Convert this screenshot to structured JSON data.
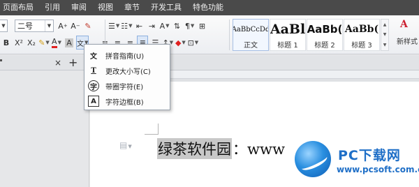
{
  "menubar": {
    "items": [
      "页面布局",
      "引用",
      "审阅",
      "视图",
      "章节",
      "开发工具",
      "特色功能"
    ]
  },
  "ribbon": {
    "font_size": "二号",
    "bold_label": "B",
    "pinyin_glyph": "文",
    "styles": [
      {
        "sample": "AaBbCcDd",
        "name": "正文"
      },
      {
        "sample": "AaBl",
        "name": "标题 1"
      },
      {
        "sample": "AaBb(",
        "name": "标题 2"
      },
      {
        "sample": "AaBb(",
        "name": "标题 3"
      }
    ],
    "new_style_label": "新样式"
  },
  "tabs": {
    "close_glyph": "×",
    "add_glyph": "+"
  },
  "dropdown": {
    "items": [
      {
        "icon": "pinyin-guide-icon",
        "glyph": "文",
        "label": "拼音指南(U)"
      },
      {
        "icon": "change-case-icon",
        "glyph": "T",
        "label": "更改大小写(C)"
      },
      {
        "icon": "enclosed-char-icon",
        "glyph": "字",
        "label": "带圈字符(E)"
      },
      {
        "icon": "char-border-icon",
        "glyph": "A",
        "label": "字符边框(B)"
      }
    ]
  },
  "document": {
    "selected_text": "绿茶软件园",
    "rest_text": "：www"
  },
  "watermark": {
    "title": "PC下载网",
    "url": "www.pcsoft.com.cn"
  },
  "colors": {
    "menubar_bg": "#4a4a4a",
    "selection_bg": "#c8c8c8",
    "watermark_blue": "#1f6fc7"
  }
}
